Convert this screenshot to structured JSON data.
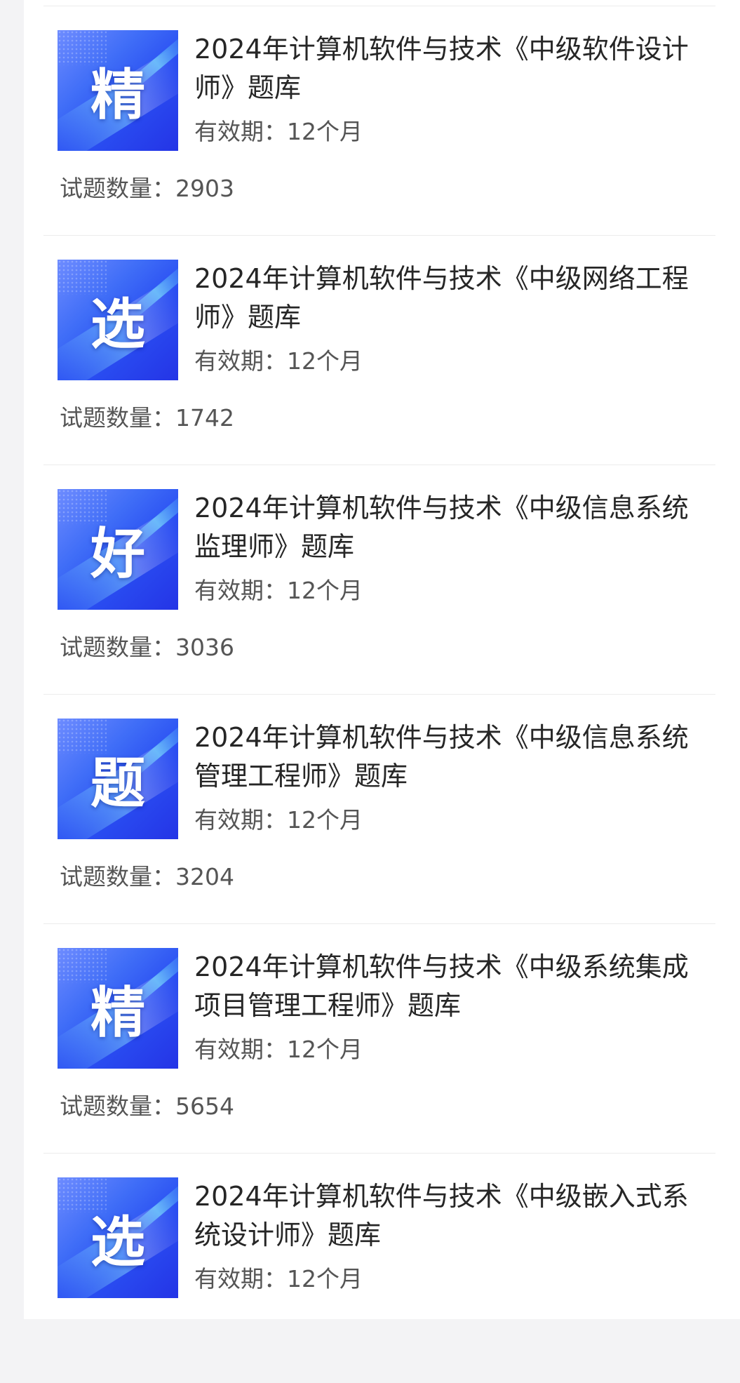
{
  "products": [
    {
      "badge": "精",
      "title": "2024年计算机软件与技术《中级软件设计师》题库",
      "validity": "有效期：12个月",
      "question_count": "试题数量：2903"
    },
    {
      "badge": "选",
      "title": "2024年计算机软件与技术《中级网络工程师》题库",
      "validity": "有效期：12个月",
      "question_count": "试题数量：1742"
    },
    {
      "badge": "好",
      "title": "2024年计算机软件与技术《中级信息系统监理师》题库",
      "validity": "有效期：12个月",
      "question_count": "试题数量：3036"
    },
    {
      "badge": "题",
      "title": "2024年计算机软件与技术《中级信息系统管理工程师》题库",
      "validity": "有效期：12个月",
      "question_count": "试题数量：3204"
    },
    {
      "badge": "精",
      "title": "2024年计算机软件与技术《中级系统集成项目管理工程师》题库",
      "validity": "有效期：12个月",
      "question_count": "试题数量：5654"
    },
    {
      "badge": "选",
      "title": "2024年计算机软件与技术《中级嵌入式系统设计师》题库",
      "validity": "有效期：12个月"
    }
  ]
}
